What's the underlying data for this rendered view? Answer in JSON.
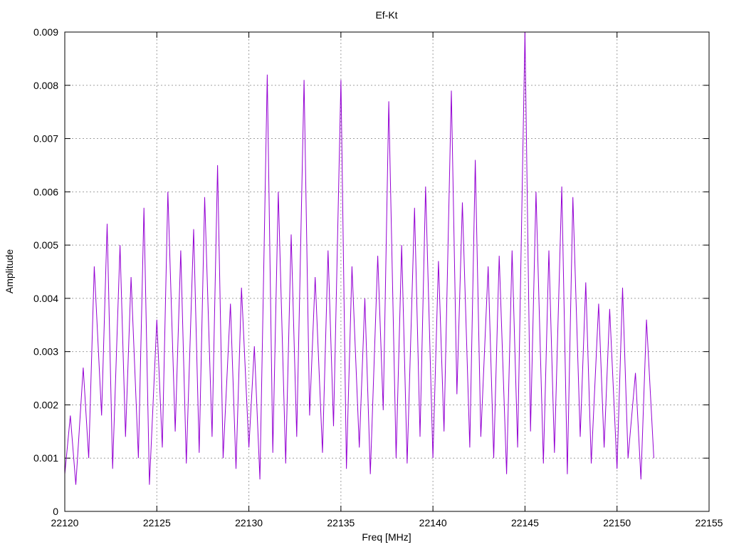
{
  "chart_data": {
    "type": "line",
    "title": "Ef-Kt",
    "xlabel": "Freq [MHz]",
    "ylabel": "Amplitude",
    "xlim": [
      22120,
      22155
    ],
    "ylim": [
      0,
      0.009
    ],
    "x_ticks": [
      "22120",
      "22125",
      "22130",
      "22135",
      "22140",
      "22145",
      "22150",
      "22155"
    ],
    "y_ticks": [
      "0",
      "0.001",
      "0.002",
      "0.003",
      "0.004",
      "0.005",
      "0.006",
      "0.007",
      "0.008",
      "0.009"
    ],
    "x_tick_values": [
      22120,
      22125,
      22130,
      22135,
      22140,
      22145,
      22150,
      22155
    ],
    "y_tick_values": [
      0,
      0.001,
      0.002,
      0.003,
      0.004,
      0.005,
      0.006,
      0.007,
      0.008,
      0.009
    ],
    "grid": true,
    "legend": "none",
    "series": [
      {
        "color": "#9400d3",
        "x": [
          22120.0,
          22120.3,
          22120.6,
          22121.0,
          22121.3,
          22121.6,
          22122.0,
          22122.3,
          22122.6,
          22123.0,
          22123.3,
          22123.6,
          22124.0,
          22124.3,
          22124.6,
          22125.0,
          22125.3,
          22125.6,
          22126.0,
          22126.3,
          22126.6,
          22127.0,
          22127.3,
          22127.6,
          22128.0,
          22128.3,
          22128.6,
          22129.0,
          22129.3,
          22129.6,
          22130.0,
          22130.3,
          22130.6,
          22131.0,
          22131.3,
          22131.6,
          22132.0,
          22132.3,
          22132.6,
          22133.0,
          22133.3,
          22133.6,
          22134.0,
          22134.3,
          22134.6,
          22135.0,
          22135.3,
          22135.6,
          22136.0,
          22136.3,
          22136.6,
          22137.0,
          22137.3,
          22137.6,
          22138.0,
          22138.3,
          22138.6,
          22139.0,
          22139.3,
          22139.6,
          22140.0,
          22140.3,
          22140.6,
          22141.0,
          22141.3,
          22141.6,
          22142.0,
          22142.3,
          22142.6,
          22143.0,
          22143.3,
          22143.6,
          22144.0,
          22144.3,
          22144.6,
          22145.0,
          22145.3,
          22145.6,
          22146.0,
          22146.3,
          22146.6,
          22147.0,
          22147.3,
          22147.6,
          22148.0,
          22148.3,
          22148.6,
          22149.0,
          22149.3,
          22149.6,
          22150.0,
          22150.3,
          22150.6,
          22151.0,
          22151.3,
          22151.6,
          22152.0
        ],
        "values": [
          0.0007,
          0.0018,
          0.0005,
          0.0027,
          0.001,
          0.0046,
          0.0018,
          0.0054,
          0.0008,
          0.005,
          0.0014,
          0.0044,
          0.001,
          0.0057,
          0.0005,
          0.0036,
          0.0012,
          0.006,
          0.0015,
          0.0049,
          0.0009,
          0.0053,
          0.0011,
          0.0059,
          0.0014,
          0.0065,
          0.001,
          0.0039,
          0.0008,
          0.0042,
          0.0012,
          0.0031,
          0.0006,
          0.0082,
          0.0011,
          0.006,
          0.0009,
          0.0052,
          0.0014,
          0.0081,
          0.0018,
          0.0044,
          0.0011,
          0.0049,
          0.0016,
          0.0081,
          0.0008,
          0.0046,
          0.0012,
          0.004,
          0.0007,
          0.0048,
          0.0019,
          0.0077,
          0.001,
          0.005,
          0.0009,
          0.0057,
          0.0014,
          0.0061,
          0.001,
          0.0047,
          0.0015,
          0.0079,
          0.0022,
          0.0058,
          0.0012,
          0.0066,
          0.0014,
          0.0046,
          0.001,
          0.0048,
          0.0007,
          0.0049,
          0.0012,
          0.009,
          0.0015,
          0.006,
          0.0009,
          0.0049,
          0.0011,
          0.0061,
          0.0007,
          0.0059,
          0.0014,
          0.0043,
          0.0009,
          0.0039,
          0.0012,
          0.0038,
          0.0008,
          0.0042,
          0.001,
          0.0026,
          0.0006,
          0.0036,
          0.001
        ]
      }
    ]
  }
}
